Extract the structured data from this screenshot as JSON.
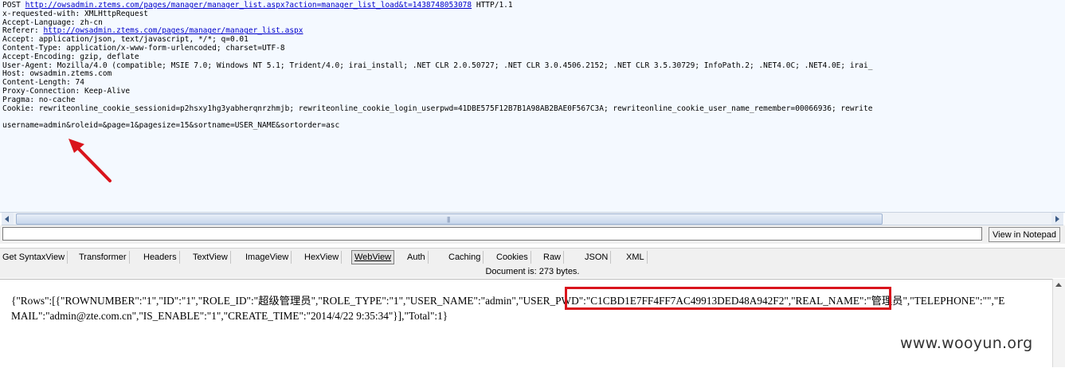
{
  "request": {
    "lines": [
      {
        "prefix": "POST ",
        "link": "http://owsadmin.ztems.com/pages/manager/manager_list.aspx?action=manager_list_load&t=1438748053078",
        "suffix": " HTTP/1.1"
      },
      {
        "text": "x-requested-with: XMLHttpRequest"
      },
      {
        "text": "Accept-Language: zh-cn"
      },
      {
        "prefix": "Referer: ",
        "link": "http://owsadmin.ztems.com/pages/manager/manager_list.aspx",
        "suffix": ""
      },
      {
        "text": "Accept: application/json, text/javascript, */*; q=0.01"
      },
      {
        "text": "Content-Type: application/x-www-form-urlencoded; charset=UTF-8"
      },
      {
        "text": "Accept-Encoding: gzip, deflate"
      },
      {
        "text": "User-Agent: Mozilla/4.0 (compatible; MSIE 7.0; Windows NT 5.1; Trident/4.0; irai_install; .NET CLR 2.0.50727; .NET CLR 3.0.4506.2152; .NET CLR 3.5.30729; InfoPath.2; .NET4.0C; .NET4.0E; irai_"
      },
      {
        "text": "Host: owsadmin.ztems.com"
      },
      {
        "text": "Content-Length: 74"
      },
      {
        "text": "Proxy-Connection: Keep-Alive"
      },
      {
        "text": "Pragma: no-cache"
      },
      {
        "text": "Cookie: rewriteonline_cookie_sessionid=p2hsxy1hg3yabherqnrzhmjb; rewriteonline_cookie_login_userpwd=41DBE575F12B7B1A98AB2BAE0F567C3A; rewriteonline_cookie_user_name_remember=00066936; rewrite"
      },
      {
        "text": ""
      },
      {
        "text": "username=admin&roleid=&page=1&pagesize=15&sortname=USER_NAME&sortorder=asc"
      }
    ]
  },
  "toolbar": {
    "command_value": "",
    "notepad_label": "View in Notepad"
  },
  "tabs": [
    {
      "label": "Get SyntaxView",
      "active": false
    },
    {
      "label": "Transformer",
      "active": false
    },
    {
      "label": "Headers",
      "active": false
    },
    {
      "label": "TextView",
      "active": false
    },
    {
      "label": "ImageView",
      "active": false
    },
    {
      "label": "HexView",
      "active": false
    },
    {
      "label": "WebView",
      "active": true
    },
    {
      "label": "Auth",
      "active": false
    },
    {
      "label": "Caching",
      "active": false
    },
    {
      "label": "Cookies",
      "active": false
    },
    {
      "label": "Raw",
      "active": false
    },
    {
      "label": "JSON",
      "active": false
    },
    {
      "label": "XML",
      "active": false
    }
  ],
  "doc_info": "Document is: 273 bytes.",
  "response": {
    "before": "{\"Rows\":[{\"ROWNUMBER\":\"1\",\"ID\":\"1\",\"ROLE_ID\":\"超级管理员\",\"ROLE_TYPE\":\"1\",\"USER_NAME\":\"admin\",",
    "highlight": "\"USER_PWD\":\"C1CBD1E7FF4FF7AC49913DED48A942F2\",",
    "after": "\"REAL_NAME\":\"管理员\",\"TELEPHONE\":\"\",\"EMAIL\":\"admin@zte.com.cn\",\"IS_ENABLE\":\"1\",\"CREATE_TIME\":\"2014/4/22 9:35:34\"}],\"Total\":1}"
  },
  "watermark": "www.wooyun.org",
  "colors": {
    "highlight_border": "#d9141c",
    "arrow": "#d9141c",
    "link": "#0000cc",
    "request_bg": "#f4f9ff"
  }
}
